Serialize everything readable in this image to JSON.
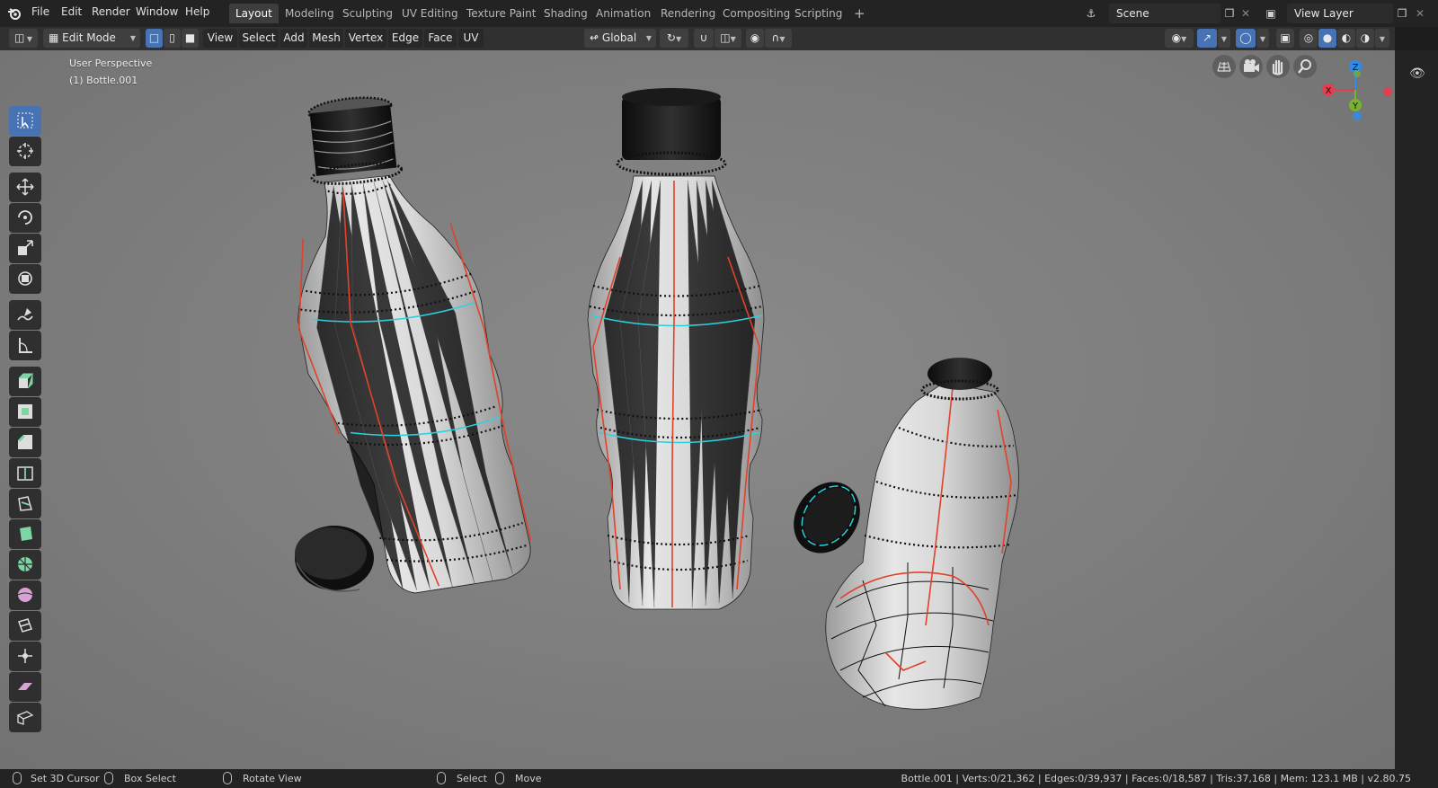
{
  "topbar": {
    "menus": [
      "File",
      "Edit",
      "Render",
      "Window",
      "Help"
    ],
    "workspaces": [
      "Layout",
      "Modeling",
      "Sculpting",
      "UV Editing",
      "Texture Paint",
      "Shading",
      "Animation",
      "Rendering",
      "Compositing",
      "Scripting"
    ],
    "active_workspace": "Layout",
    "add_workspace": "+",
    "scene_name": "Scene",
    "view_layer_name": "View Layer"
  },
  "header": {
    "mode": "Edit Mode",
    "menus": [
      "View",
      "Select",
      "Add",
      "Mesh",
      "Vertex",
      "Edge",
      "Face",
      "UV"
    ],
    "transform_orientation": "Global"
  },
  "viewport": {
    "view_name": "User Perspective",
    "object_label": "(1) Bottle.001",
    "gizmo_axes": {
      "x": "X",
      "y": "Y",
      "z": "Z"
    },
    "colors": {
      "x_axis": "#e2404f",
      "y_axis": "#79b32b",
      "z_axis": "#2d8ceb",
      "seam": "#e0422a",
      "selected_edge": "#2ad2e0",
      "vertex": "#111111"
    }
  },
  "toolbar": {
    "tools": [
      "select-box-icon",
      "cursor-icon",
      "move-icon",
      "rotate-icon",
      "scale-icon",
      "transform-icon",
      "annotate-icon",
      "measure-icon",
      "extrude-icon",
      "inset-icon",
      "bevel-icon",
      "loop-cut-icon",
      "knife-icon",
      "poly-build-icon",
      "spin-icon",
      "smooth-icon",
      "edge-slide-icon",
      "shrink-fatten-icon",
      "shear-icon",
      "rip-icon"
    ]
  },
  "statusbar": {
    "left": [
      {
        "label": "Set 3D Cursor"
      },
      {
        "label": "Box Select"
      },
      {
        "label": "Rotate View"
      },
      {
        "label": "Select"
      },
      {
        "label": "Move"
      }
    ],
    "stats": "Bottle.001 | Verts:0/21,362 | Edges:0/39,937 | Faces:0/18,587 | Tris:37,168 | Mem: 123.1 MB | v2.80.75"
  }
}
